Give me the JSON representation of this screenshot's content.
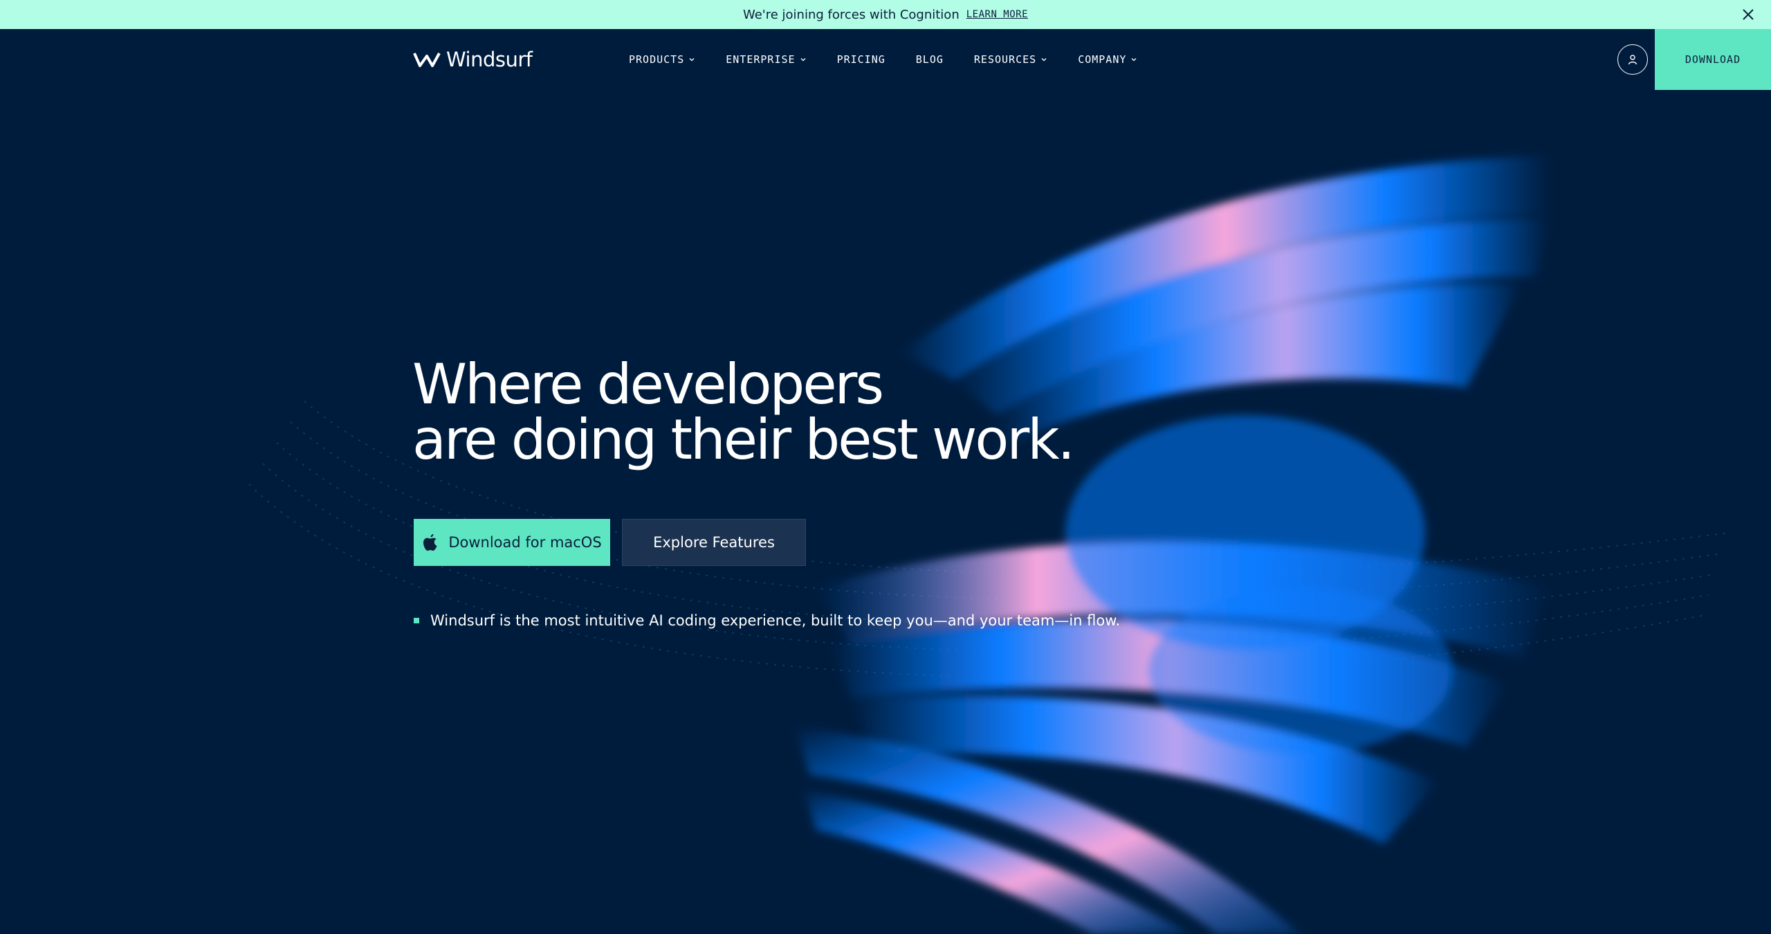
{
  "banner": {
    "message": "We're joining forces with Cognition",
    "link_label": "LEARN MORE"
  },
  "nav": {
    "brand": "Windsurf",
    "items": [
      {
        "label": "PRODUCTS",
        "dropdown": true
      },
      {
        "label": "ENTERPRISE",
        "dropdown": true
      },
      {
        "label": "PRICING",
        "dropdown": false
      },
      {
        "label": "BLOG",
        "dropdown": false
      },
      {
        "label": "RESOURCES",
        "dropdown": true
      },
      {
        "label": "COMPANY",
        "dropdown": true
      }
    ],
    "download_label": "DOWNLOAD"
  },
  "hero": {
    "headline_line1": "Where developers",
    "headline_line2": "are doing their best work.",
    "primary_cta": "Download for macOS",
    "secondary_cta": "Explore Features",
    "tagline": "Windsurf is the most intuitive AI coding experience, built to keep you—and your team—in flow."
  },
  "colors": {
    "background": "#001c3d",
    "banner": "#b2fde6",
    "accent": "#5ee6c3",
    "secondary_button": "#1b3250",
    "art_blue": "#0a7cff",
    "art_pink": "#f5a6dc"
  },
  "icons": {
    "logo": "windsurf-logo-icon",
    "close": "close-icon",
    "account": "user-icon",
    "primary_cta": "apple-icon",
    "dropdown": "chevron-down-icon"
  }
}
